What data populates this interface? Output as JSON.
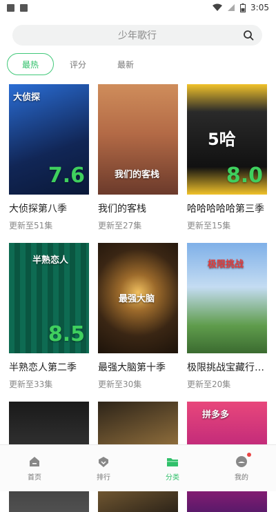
{
  "status_bar": {
    "time": "3:05"
  },
  "search": {
    "placeholder": "少年歌行"
  },
  "tabs": [
    {
      "label": "最热",
      "active": true
    },
    {
      "label": "评分",
      "active": false
    },
    {
      "label": "最新",
      "active": false
    }
  ],
  "cards": [
    {
      "title": "大侦探第八季",
      "sub": "更新至51集",
      "rating": "7.6",
      "poster_text": "大侦探",
      "poster_color": "#1c3a80"
    },
    {
      "title": "我们的客栈",
      "sub": "更新至27集",
      "rating": "",
      "poster_text": "我们的客栈",
      "poster_color": "#a3553a"
    },
    {
      "title": "哈哈哈哈哈第三季",
      "sub": "更新至15集",
      "rating": "8.0",
      "poster_text": "5哈",
      "poster_color": "#222222"
    },
    {
      "title": "半熟恋人第二季",
      "sub": "更新至33集",
      "rating": "8.5",
      "poster_text": "半熟恋人",
      "poster_color": "#0d5c48"
    },
    {
      "title": "最强大脑第十季",
      "sub": "更新至30集",
      "rating": "",
      "poster_text": "最强大脑",
      "poster_color": "#3a2614"
    },
    {
      "title": "极限挑战宝藏行…",
      "sub": "更新至20集",
      "rating": "",
      "poster_text": "极限挑战",
      "poster_color": "#5c8ac9"
    },
    {
      "title": "",
      "sub": "",
      "rating": "",
      "poster_text": "",
      "poster_color": "#303030"
    },
    {
      "title": "",
      "sub": "",
      "rating": "",
      "poster_text": "",
      "poster_color": "#4a3b22"
    },
    {
      "title": "",
      "sub": "",
      "rating": "",
      "poster_text": "拼多多",
      "poster_color": "#d03090"
    }
  ],
  "bottom_nav": [
    {
      "label": "首页",
      "icon": "home-icon",
      "active": false
    },
    {
      "label": "排行",
      "icon": "rank-icon",
      "active": false
    },
    {
      "label": "分类",
      "icon": "folder-icon",
      "active": true
    },
    {
      "label": "我的",
      "icon": "profile-icon",
      "active": false,
      "badge": true
    }
  ],
  "colors": {
    "accent": "#30c06a",
    "rating": "#3fcf5e"
  }
}
